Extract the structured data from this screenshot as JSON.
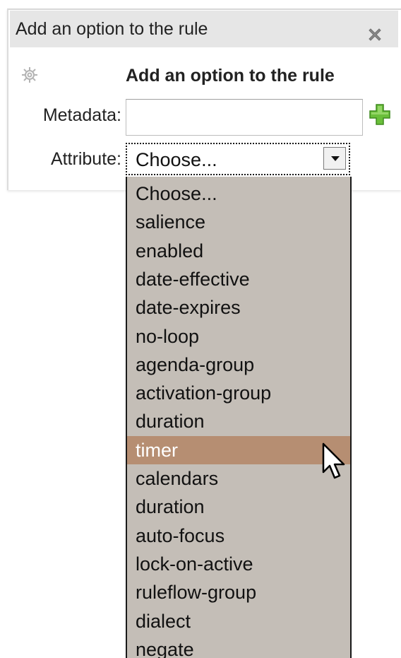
{
  "dialog": {
    "title": "Add an option to the rule",
    "close_icon": "close-icon",
    "header_icon": "gear-icon",
    "header_label": "Add an option to the rule"
  },
  "form": {
    "metadata_label": "Metadata:",
    "metadata_value": "",
    "metadata_placeholder": "",
    "add_icon": "plus-icon",
    "attribute_label": "Attribute:",
    "attribute_selected": "Choose..."
  },
  "dropdown": {
    "options": [
      "Choose...",
      "salience",
      "enabled",
      "date-effective",
      "date-expires",
      "no-loop",
      "agenda-group",
      "activation-group",
      "duration",
      "timer",
      "calendars",
      "duration",
      "auto-focus",
      "lock-on-active",
      "ruleflow-group",
      "dialect",
      "negate"
    ],
    "highlighted": "timer"
  },
  "colors": {
    "title_bar": "#e6e6e6",
    "dropdown_bg": "#c4beb7",
    "highlight": "#b68e72",
    "add_icon_green": "#6abf3a"
  }
}
